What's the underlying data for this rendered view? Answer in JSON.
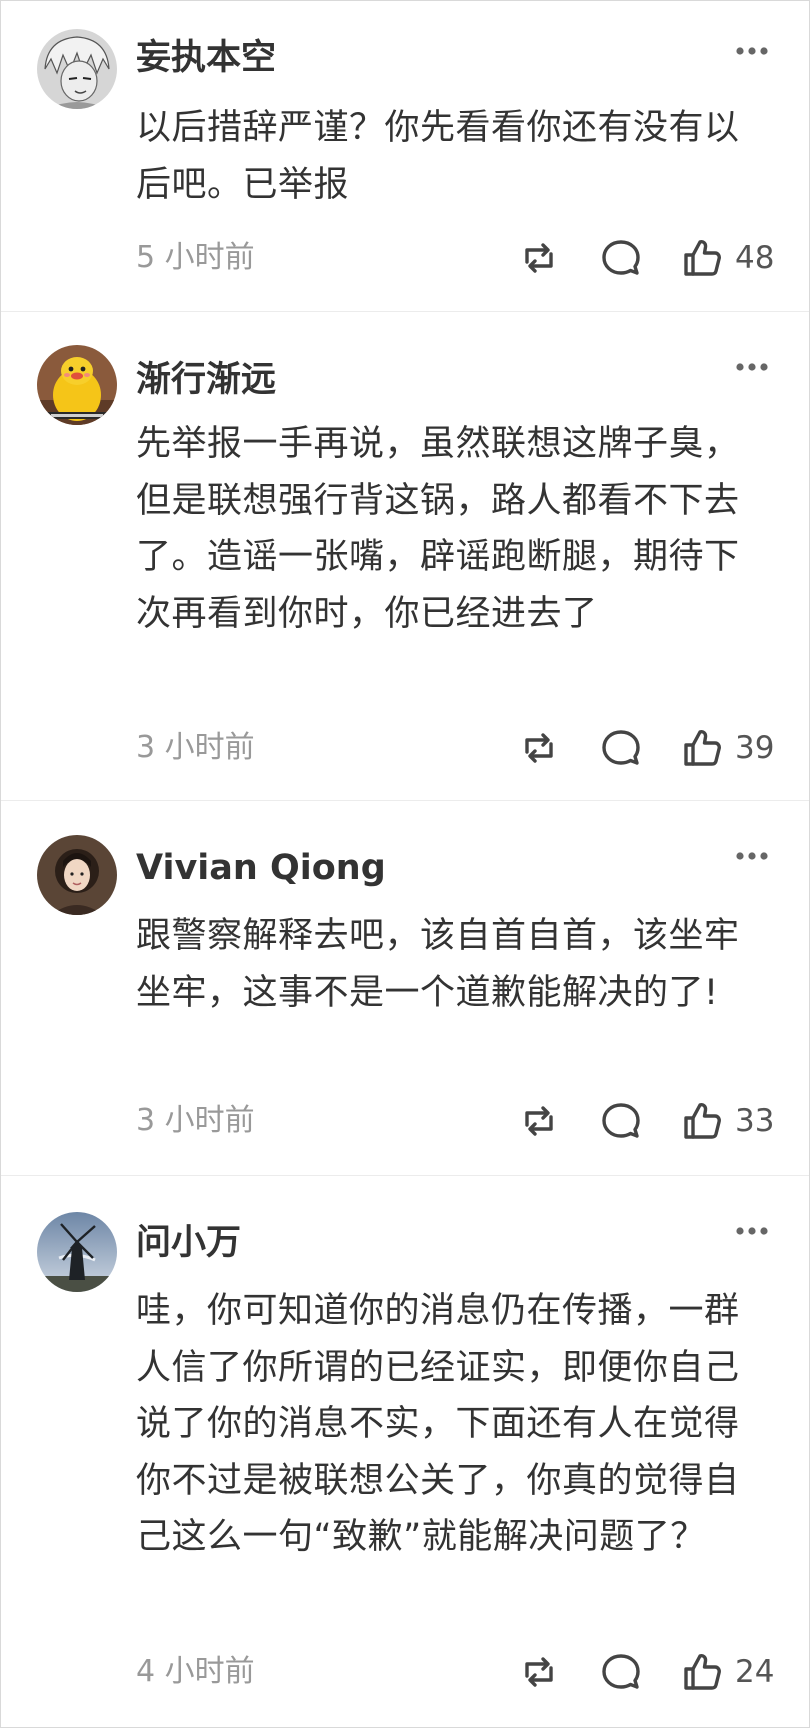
{
  "comments": [
    {
      "username": "妄执本空",
      "avatar_icon": "anime-character-avatar",
      "text": "以后措辞严谨？你先看看你还有没有以后吧。已举报",
      "time": "5 小时前",
      "likes": "48"
    },
    {
      "username": "渐行渐远",
      "avatar_icon": "yellow-mascot-avatar",
      "text": "先举报一手再说，虽然联想这牌子臭，但是联想强行背这锅，路人都看不下去了。造谣一张嘴，辟谣跑断腿，期待下次再看到你时，你已经进去了",
      "time": "3 小时前",
      "likes": "39"
    },
    {
      "username": "Vivian Qiong",
      "avatar_icon": "photo-portrait-avatar",
      "text": "跟警察解释去吧，该自首自首，该坐牢坐牢，这事不是一个道歉能解决的了!",
      "time": "3 小时前",
      "likes": "33"
    },
    {
      "username": "问小万",
      "avatar_icon": "windmill-avatar",
      "text": "哇，你可知道你的消息仍在传播，一群人信了你所谓的已经证实，即便你自己说了你的消息不实，下面还有人在觉得你不过是被联想公关了，你真的觉得自己这么一句“致歉”就能解决问题了？",
      "time": "4 小时前",
      "likes": "24"
    }
  ],
  "icons": {
    "more": "more-dots-icon",
    "repost": "repost-icon",
    "reply": "reply-icon",
    "like": "thumbs-up-icon"
  },
  "colors": {
    "text": "#333333",
    "meta": "#999999",
    "icon": "#444444",
    "divider": "#ececec"
  }
}
